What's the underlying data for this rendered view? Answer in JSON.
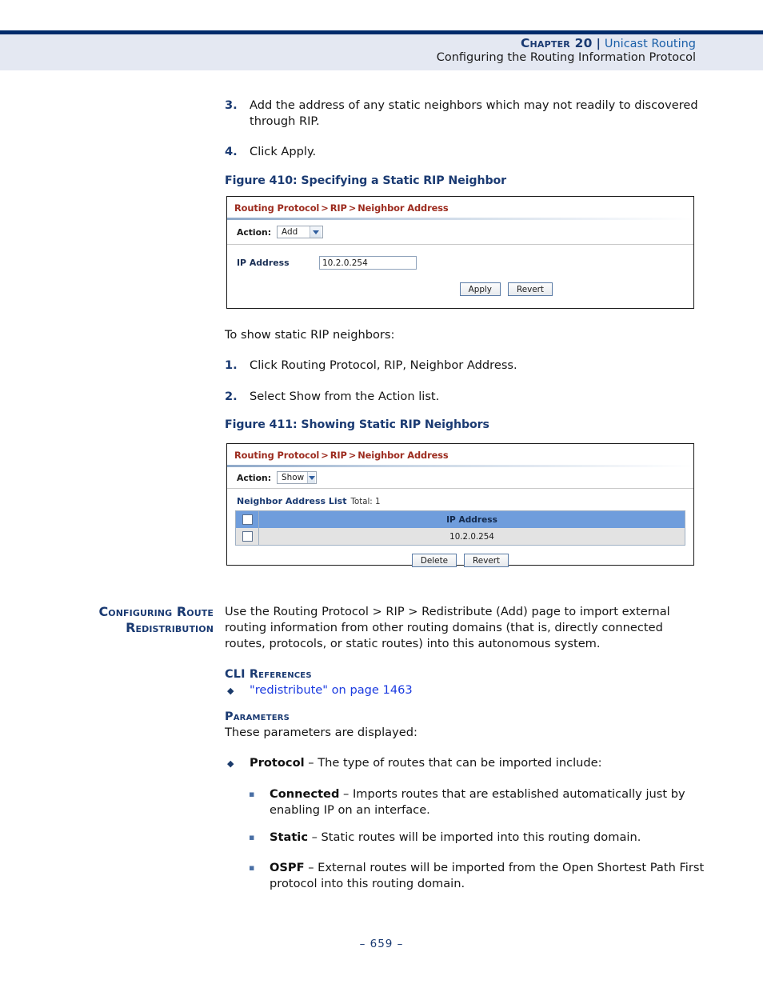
{
  "header": {
    "chapter_label": "Chapter 20",
    "separator": "|",
    "chapter_topic": "Unicast Routing",
    "subtitle": "Configuring the Routing Information Protocol"
  },
  "steps_top": [
    {
      "num": "3.",
      "text": "Add the address of any static neighbors which may not readily to discovered through RIP."
    },
    {
      "num": "4.",
      "text": "Click Apply."
    }
  ],
  "figure410": {
    "caption": "Figure 410:  Specifying a Static RIP Neighbor",
    "breadcrumb": {
      "part1": "Routing Protocol",
      "sep1": ">",
      "part2": "RIP",
      "sep2": ">",
      "part3": "Neighbor Address"
    },
    "action_label": "Action:",
    "action_value": "Add",
    "field_label": "IP Address",
    "field_value": "10.2.0.254",
    "buttons": [
      "Apply",
      "Revert"
    ]
  },
  "intro_show": "To show static RIP neighbors:",
  "steps_show": [
    {
      "num": "1.",
      "text": "Click Routing Protocol, RIP, Neighbor Address."
    },
    {
      "num": "2.",
      "text": "Select Show from the Action list."
    }
  ],
  "figure411": {
    "caption": "Figure 411:  Showing Static RIP Neighbors",
    "breadcrumb": {
      "part1": "Routing Protocol",
      "sep1": ">",
      "part2": "RIP",
      "sep2": ">",
      "part3": "Neighbor Address"
    },
    "action_label": "Action:",
    "action_value": "Show",
    "list_title": "Neighbor Address List",
    "list_total": "Total: 1",
    "table": {
      "columns": [
        "IP Address"
      ],
      "rows": [
        [
          "10.2.0.254"
        ]
      ]
    },
    "buttons": [
      "Delete",
      "Revert"
    ]
  },
  "section": {
    "heading_line1": "Configuring Route",
    "heading_line2": "Redistribution",
    "body": "Use the Routing Protocol > RIP > Redistribute (Add) page to import external routing information from other routing domains (that is, directly connected routes, protocols, or static routes) into this autonomous system."
  },
  "cli_references": {
    "heading": "CLI References",
    "items": [
      {
        "bullet": "◆",
        "link_text": "\"redistribute\" on page 1463"
      }
    ]
  },
  "parameters": {
    "heading": "Parameters",
    "intro": "These parameters are displayed:",
    "items": [
      {
        "bullet": "◆",
        "term": "Protocol",
        "dash": " – ",
        "text": "The type of routes that can be imported include:",
        "sub_items": [
          {
            "bullet": "▪",
            "term": "Connected",
            "dash": " – ",
            "text": "Imports routes that are established automatically just by enabling IP on an interface."
          },
          {
            "bullet": "▪",
            "term": "Static",
            "dash": " – ",
            "text": "Static routes will be imported into this routing domain."
          },
          {
            "bullet": "▪",
            "term": "OSPF",
            "dash": " – ",
            "text": "External routes will be imported from the Open Shortest Path First protocol into this routing domain."
          }
        ]
      }
    ]
  },
  "footer": {
    "page_number": "–  659  –"
  },
  "colors": {
    "navy": "#1a3a72",
    "rule": "#002b6b",
    "header_band": "#e4e8f2",
    "crumb_red": "#9c2b1e",
    "table_header_blue": "#6f9ddc",
    "link_blue": "#1a3ae0"
  }
}
